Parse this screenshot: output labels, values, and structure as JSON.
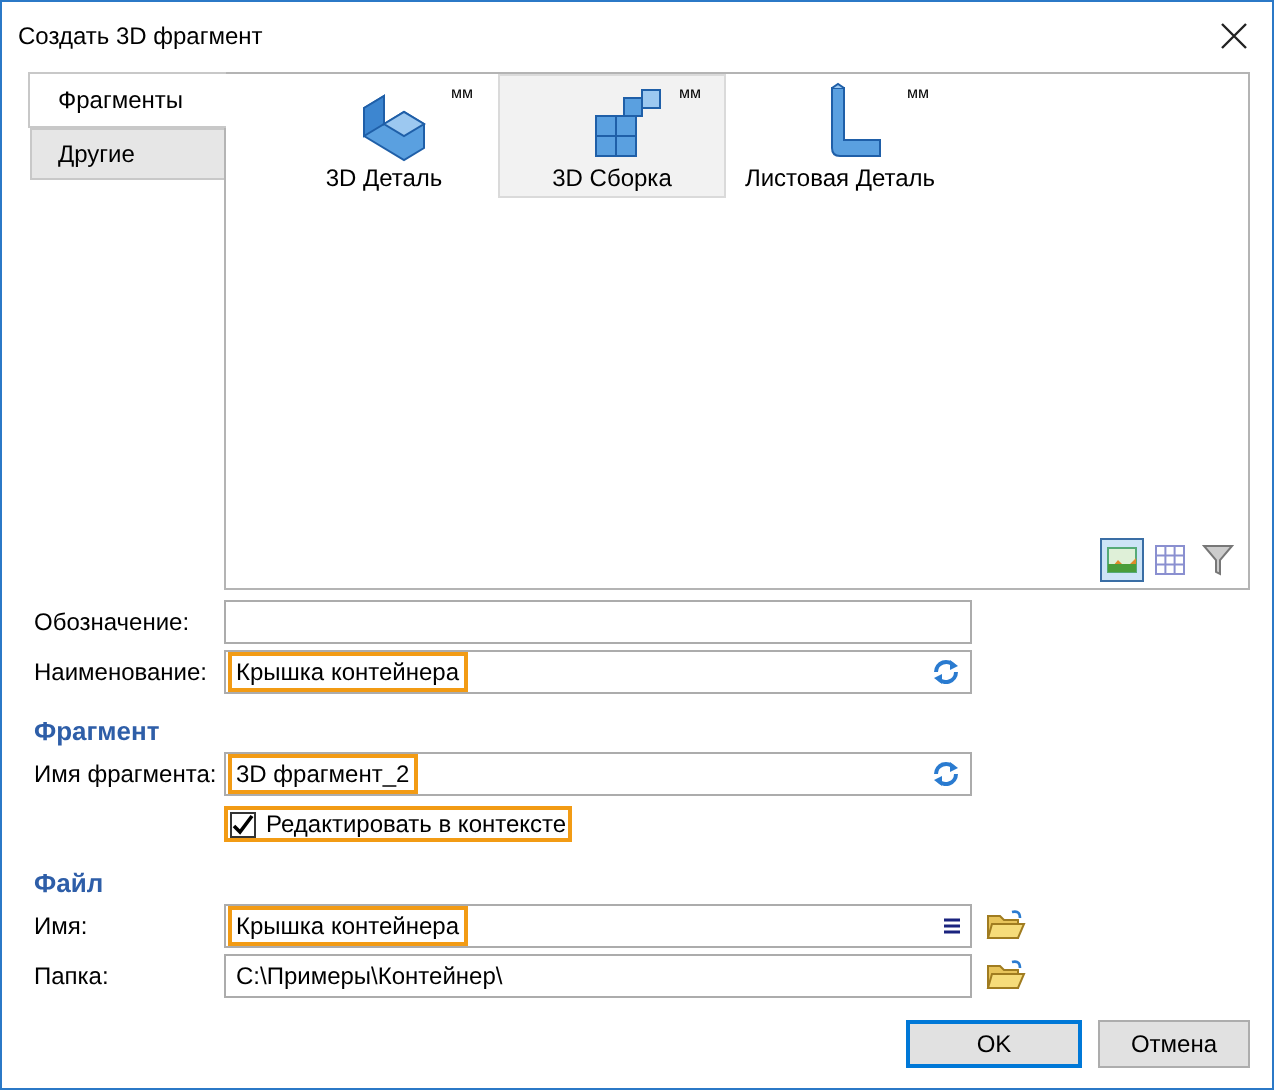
{
  "window": {
    "title": "Создать 3D фрагмент"
  },
  "tabs": [
    {
      "label": "Фрагменты",
      "selected": true
    },
    {
      "label": "Другие",
      "selected": false
    }
  ],
  "templates": [
    {
      "kind": "part",
      "label": "3D Деталь",
      "unit": "мм",
      "selected": false
    },
    {
      "kind": "assembly",
      "label": "3D Сборка",
      "unit": "мм",
      "selected": true
    },
    {
      "kind": "sheet",
      "label": "Листовая Деталь",
      "unit": "мм",
      "selected": false
    }
  ],
  "view_buttons": [
    {
      "kind": "thumbnails",
      "selected": true
    },
    {
      "kind": "table",
      "selected": false
    },
    {
      "kind": "filter",
      "selected": false
    }
  ],
  "form": [
    {
      "kind": "field",
      "label": "Обозначение:",
      "highlighted": false
    },
    {
      "kind": "field",
      "label": "Наименование:",
      "value": "Крышка контейнера",
      "refresh_button": true,
      "highlighted": true
    },
    {
      "kind": "heading",
      "text": "Фрагмент"
    },
    {
      "kind": "field",
      "label": "Имя фрагмента:",
      "value": "3D фрагмент_2",
      "refresh_button": true,
      "highlighted": true
    },
    {
      "kind": "checkbox",
      "label": "Редактировать в контексте",
      "checked": true,
      "highlighted": true
    },
    {
      "kind": "heading",
      "text": "Файл"
    },
    {
      "kind": "field",
      "label": "Имя:",
      "value": "Крышка контейнера",
      "list_button": true,
      "browse": true,
      "highlighted": true
    },
    {
      "kind": "field",
      "label": "Папка:",
      "value": "C:\\Примеры\\Контейнер\\",
      "browse": true,
      "highlighted": false
    }
  ],
  "buttons": [
    {
      "label": "OK",
      "default": true
    },
    {
      "label": "Отмена",
      "default": false
    }
  ]
}
